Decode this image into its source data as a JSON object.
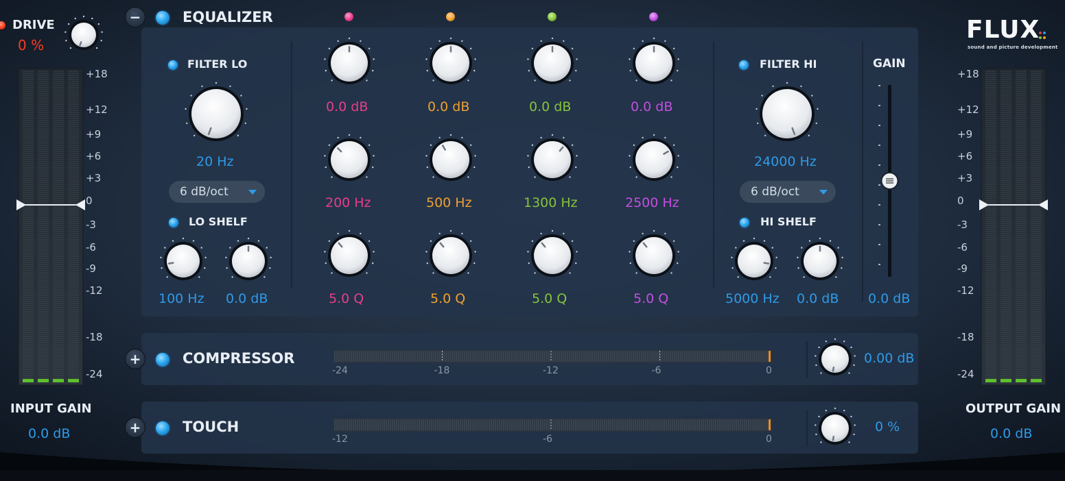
{
  "brand": {
    "logo": "FLUX",
    "tagline": "sound and picture development"
  },
  "colors": {
    "accent": "#2e9be8",
    "band1": "#e83e8c",
    "band2": "#f0a030",
    "band3": "#86c43a",
    "band4": "#c34fe0",
    "drive": "#ff3b1f",
    "meter_green": "#5fbf2f"
  },
  "drive": {
    "label": "DRIVE",
    "value": "0 %"
  },
  "input": {
    "label": "INPUT GAIN",
    "value": "0.0 dB",
    "scale": [
      "+18",
      "+12",
      "+9",
      "+6",
      "+3",
      "0",
      "-3",
      "-6",
      "-9",
      "-12",
      "-18",
      "-24"
    ]
  },
  "output": {
    "label": "OUTPUT GAIN",
    "value": "0.0 dB",
    "scale": [
      "+18",
      "+12",
      "+9",
      "+6",
      "+3",
      "0",
      "-3",
      "-6",
      "-9",
      "-12",
      "-18",
      "-24"
    ]
  },
  "equalizer": {
    "toggle": "−",
    "title": "EQUALIZER",
    "filter_lo": {
      "label": "FILTER LO",
      "freq": "20 Hz",
      "slope": "6 dB/oct"
    },
    "lo_shelf": {
      "label": "LO SHELF",
      "freq": "100 Hz",
      "gain": "0.0 dB"
    },
    "bands": [
      {
        "gain": "0.0 dB",
        "freq": "200 Hz",
        "q": "5.0 Q"
      },
      {
        "gain": "0.0 dB",
        "freq": "500 Hz",
        "q": "5.0 Q"
      },
      {
        "gain": "0.0 dB",
        "freq": "1300 Hz",
        "q": "5.0 Q"
      },
      {
        "gain": "0.0 dB",
        "freq": "2500 Hz",
        "q": "5.0 Q"
      }
    ],
    "filter_hi": {
      "label": "FILTER HI",
      "freq": "24000 Hz",
      "slope": "6 dB/oct"
    },
    "hi_shelf": {
      "label": "HI SHELF",
      "freq": "5000 Hz",
      "gain": "0.0 dB"
    },
    "gain": {
      "label": "GAIN",
      "value": "0.0 dB",
      "level": 0.5
    }
  },
  "compressor": {
    "toggle": "+",
    "title": "COMPRESSOR",
    "value": "0.00 dB",
    "ticks": [
      "-24",
      "-18",
      "-12",
      "-6",
      "0"
    ]
  },
  "touch": {
    "toggle": "+",
    "title": "TOUCH",
    "value": "0 %",
    "ticks": [
      "-12",
      "-6",
      "0"
    ]
  }
}
